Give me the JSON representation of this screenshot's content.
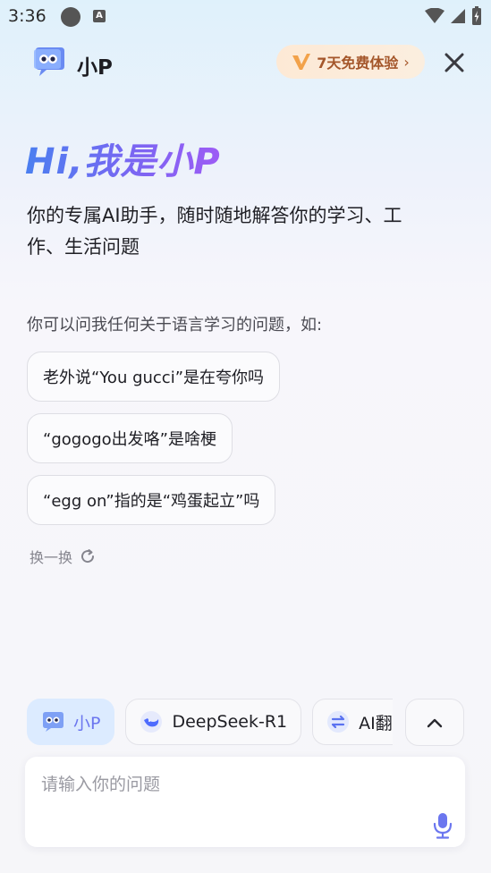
{
  "status_bar": {
    "time": "3:36"
  },
  "header": {
    "title": "小P",
    "trial_label": "7天免费体验",
    "trial_chevron": "›"
  },
  "hero": {
    "title": "Hi,我是小P",
    "subtitle": "你的专属AI助手，随时随地解答你的学习、工作、生活问题"
  },
  "prompt_intro": "你可以问我任何关于语言学习的问题，如:",
  "suggestions": [
    "老外说“You gucci”是在夸你吗",
    "“gogogo出发咯”是啥梗",
    "“egg on”指的是“鸡蛋起立”吗"
  ],
  "refresh_label": "换一换",
  "models": [
    {
      "label": "小P",
      "icon": "xiaop-robot-icon",
      "active": true
    },
    {
      "label": "DeepSeek-R1",
      "icon": "deepseek-whale-icon",
      "active": false
    },
    {
      "label": "AI翻译",
      "icon": "translate-swap-icon",
      "active": false
    }
  ],
  "input": {
    "placeholder": "请输入你的问题",
    "value": ""
  },
  "colors": {
    "accent": "#6b76ef",
    "trial_text": "#a4562a",
    "trial_bg": "#fde9d5",
    "active_chip": "#dcebff"
  }
}
